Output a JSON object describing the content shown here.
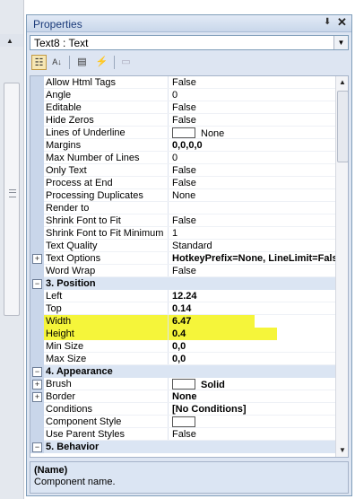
{
  "panel": {
    "title": "Properties",
    "pin_glyph": "⬇",
    "close_glyph": "✕"
  },
  "selector": {
    "value": "Text8 : Text"
  },
  "toolbar": {
    "buttons": [
      {
        "name": "categorized-icon",
        "glyph": "☷"
      },
      {
        "name": "alphabetical-icon",
        "glyph": "A↓"
      },
      {
        "name": "properties-icon",
        "glyph": "▤"
      },
      {
        "name": "events-icon",
        "glyph": "⚡"
      },
      {
        "name": "property-pages-icon",
        "glyph": "▭"
      }
    ]
  },
  "grid": {
    "rows": [
      {
        "name": "Allow Html Tags",
        "value": "False"
      },
      {
        "name": "Angle",
        "value": "0"
      },
      {
        "name": "Editable",
        "value": "False"
      },
      {
        "name": "Hide Zeros",
        "value": "False"
      },
      {
        "name": "Lines of Underline",
        "value": "None"
      },
      {
        "name": "Margins",
        "value": "0,0,0,0"
      },
      {
        "name": "Max Number of Lines",
        "value": "0"
      },
      {
        "name": "Only Text",
        "value": "False"
      },
      {
        "name": "Process at End",
        "value": "False"
      },
      {
        "name": "Processing Duplicates",
        "value": "None"
      },
      {
        "name": "Render to",
        "value": ""
      },
      {
        "name": "Shrink Font to Fit",
        "value": "False"
      },
      {
        "name": "Shrink Font to Fit Minimum",
        "value": "1"
      },
      {
        "name": "Text Quality",
        "value": "Standard"
      },
      {
        "name": "Text Options",
        "value": "HotkeyPrefix=None, LineLimit=False"
      },
      {
        "name": "Word Wrap",
        "value": "False"
      },
      {
        "name": "3. Position",
        "value": ""
      },
      {
        "name": "Left",
        "value": "12.24"
      },
      {
        "name": "Top",
        "value": "0.14"
      },
      {
        "name": "Width",
        "value": "6.47"
      },
      {
        "name": "Height",
        "value": "0.4"
      },
      {
        "name": "Min Size",
        "value": "0,0"
      },
      {
        "name": "Max Size",
        "value": "0,0"
      },
      {
        "name": "4. Appearance",
        "value": ""
      },
      {
        "name": "Brush",
        "value": "Solid"
      },
      {
        "name": "Border",
        "value": "None"
      },
      {
        "name": "Conditions",
        "value": "[No Conditions]"
      },
      {
        "name": "Component Style",
        "value": ""
      },
      {
        "name": "Use Parent Styles",
        "value": "False"
      },
      {
        "name": "5. Behavior",
        "value": ""
      }
    ]
  },
  "description": {
    "title": "(Name)",
    "text": "Component name."
  },
  "colors": {
    "highlight": "#f5f53a",
    "category_background": "#dbe5f3",
    "panel_background": "#dde5f2"
  }
}
